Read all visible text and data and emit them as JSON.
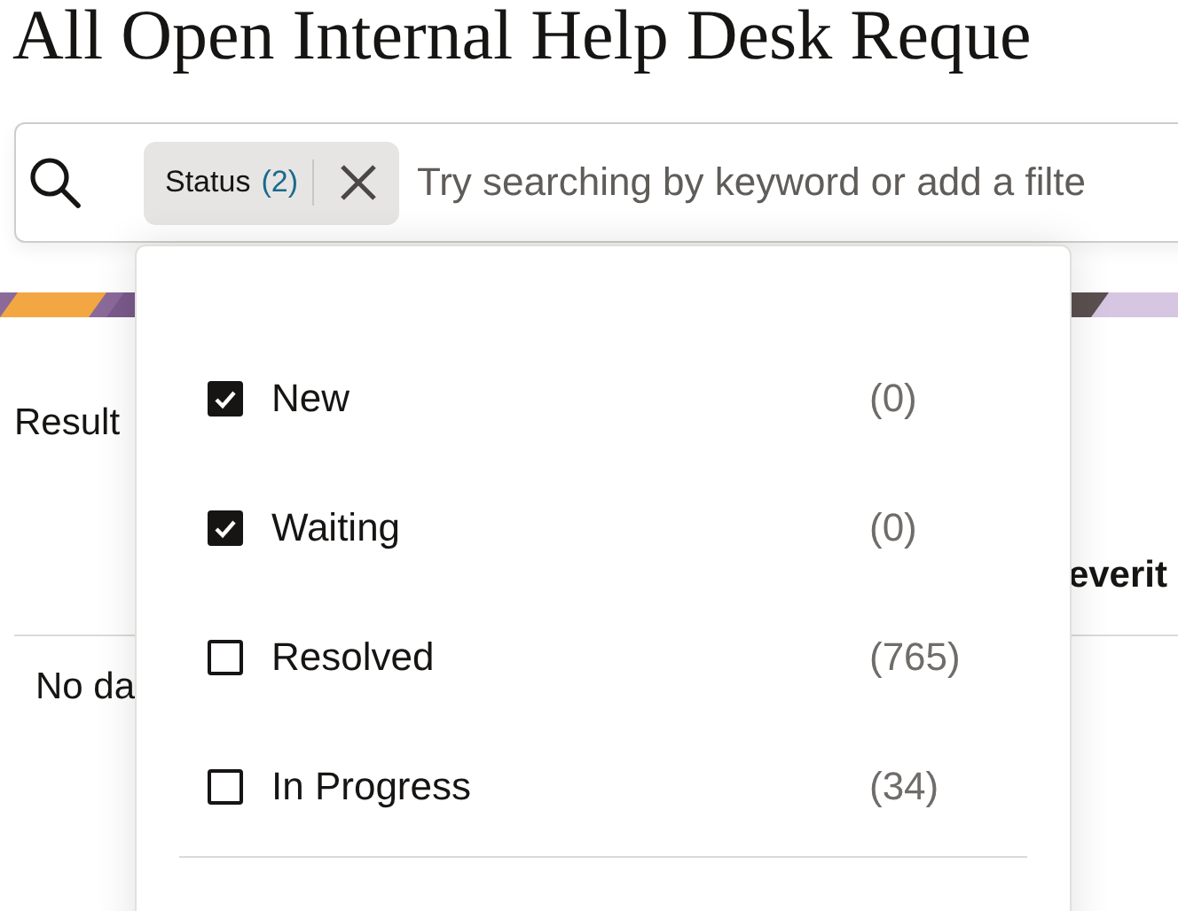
{
  "page_title": "All Open Internal Help Desk Reque",
  "search": {
    "placeholder": "Try searching by keyword or add a filte",
    "filter_chip": {
      "label": "Status",
      "count": "(2)"
    }
  },
  "results_label": "Result",
  "table": {
    "column_header": "everit",
    "empty_message": "No da"
  },
  "status_dropdown": {
    "options": [
      {
        "label": "New",
        "count": "(0)",
        "checked": true
      },
      {
        "label": "Waiting",
        "count": "(0)",
        "checked": true
      },
      {
        "label": "Resolved",
        "count": "(765)",
        "checked": false
      },
      {
        "label": "In Progress",
        "count": "(34)",
        "checked": false
      }
    ]
  }
}
